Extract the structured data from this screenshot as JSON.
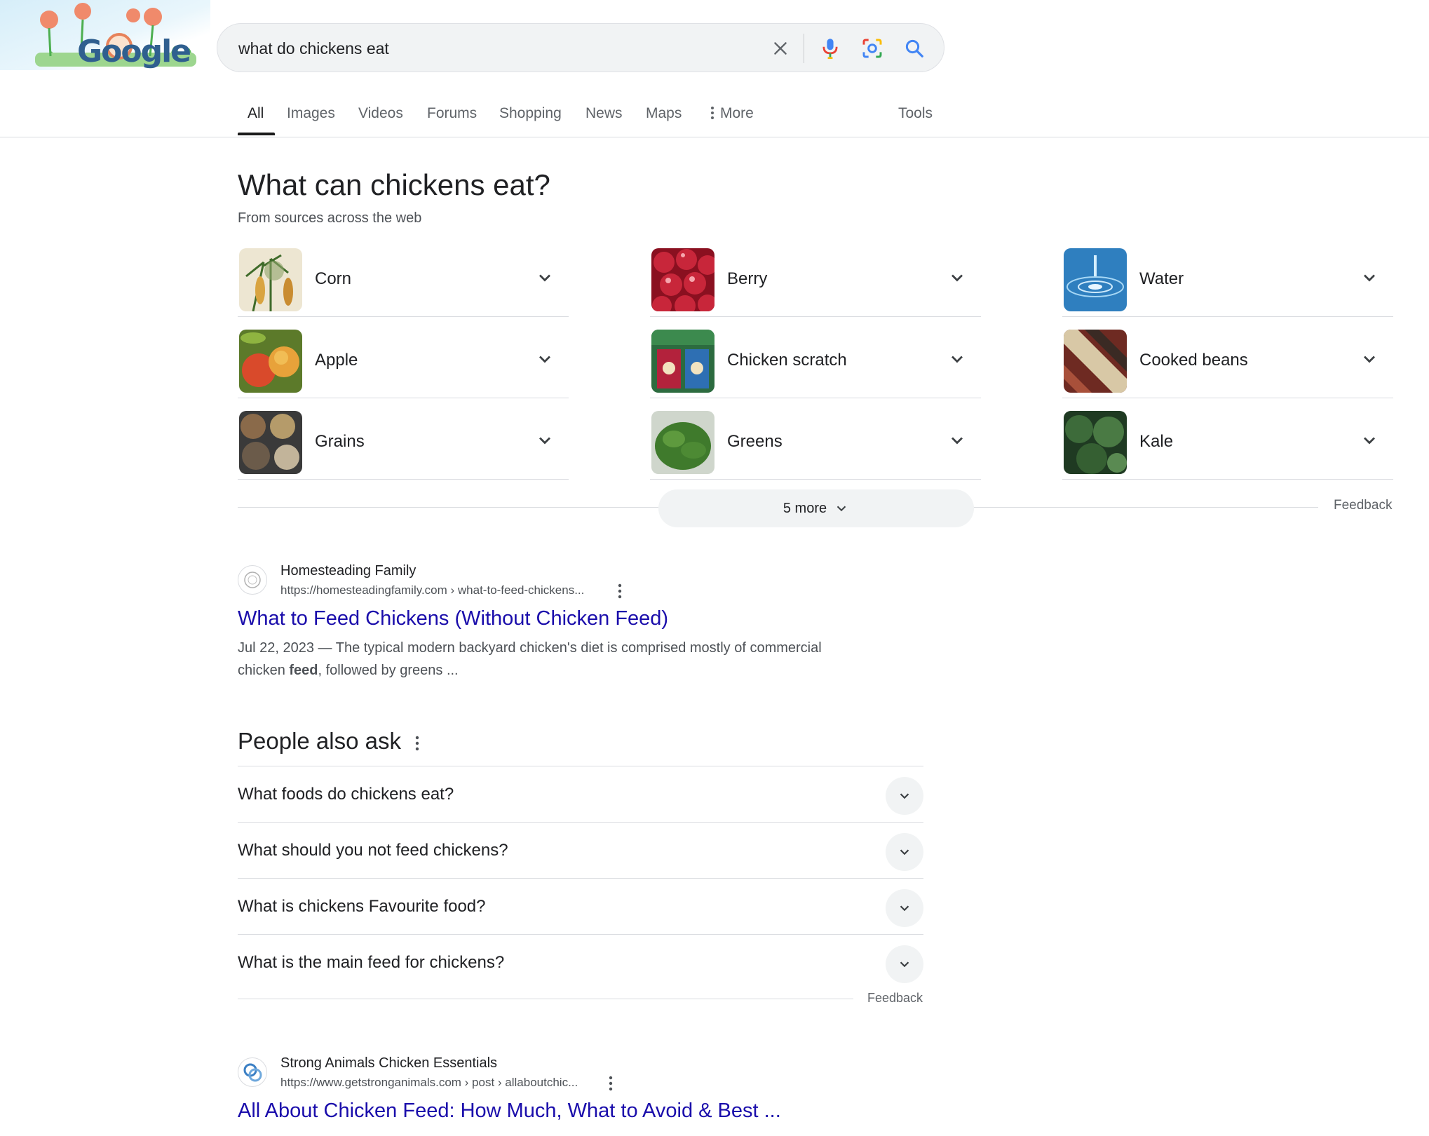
{
  "header": {
    "logo_text": "Google",
    "search": {
      "value": "what do chickens eat",
      "clear_icon": "close-icon",
      "voice_icon": "microphone-icon",
      "lens_icon": "camera-lens-icon",
      "search_icon": "search-icon"
    }
  },
  "tabs": {
    "items": [
      {
        "label": "All",
        "active": true
      },
      {
        "label": "Images"
      },
      {
        "label": "Videos"
      },
      {
        "label": "Forums"
      },
      {
        "label": "Shopping"
      },
      {
        "label": "News"
      },
      {
        "label": "Maps"
      },
      {
        "label": "More"
      }
    ],
    "tools": "Tools"
  },
  "foods": {
    "title": "What can chickens eat?",
    "subtitle": "From sources across the web",
    "items": [
      {
        "label": "Corn"
      },
      {
        "label": "Berry"
      },
      {
        "label": "Water"
      },
      {
        "label": "Apple"
      },
      {
        "label": "Chicken scratch"
      },
      {
        "label": "Cooked beans"
      },
      {
        "label": "Grains"
      },
      {
        "label": "Greens"
      },
      {
        "label": "Kale"
      }
    ],
    "more_label": "5 more",
    "feedback": "Feedback"
  },
  "results": [
    {
      "site": "Homesteading Family",
      "url": "https://homesteadingfamily.com › what-to-feed-chickens...",
      "title": "What to Feed Chickens (Without Chicken Feed)",
      "snippet_pre": "Jul 22, 2023 — The typical modern backyard chicken's diet is comprised mostly of commercial chicken ",
      "snippet_bold": "feed",
      "snippet_post": ", followed by greens ..."
    },
    {
      "site": "Strong Animals Chicken Essentials",
      "url": "https://www.getstronganimals.com › post › allaboutchic...",
      "title": "All About Chicken Feed: How Much, What to Avoid & Best ..."
    }
  ],
  "paa": {
    "title": "People also ask",
    "questions": [
      "What foods do chickens eat?",
      "What should you not feed chickens?",
      "What is chickens Favourite food?",
      "What is the main feed for chickens?"
    ],
    "feedback": "Feedback"
  },
  "colors": {
    "link": "#1a0dab",
    "text": "#202124",
    "muted": "#4d5156",
    "chip_bg": "#f1f3f4"
  }
}
